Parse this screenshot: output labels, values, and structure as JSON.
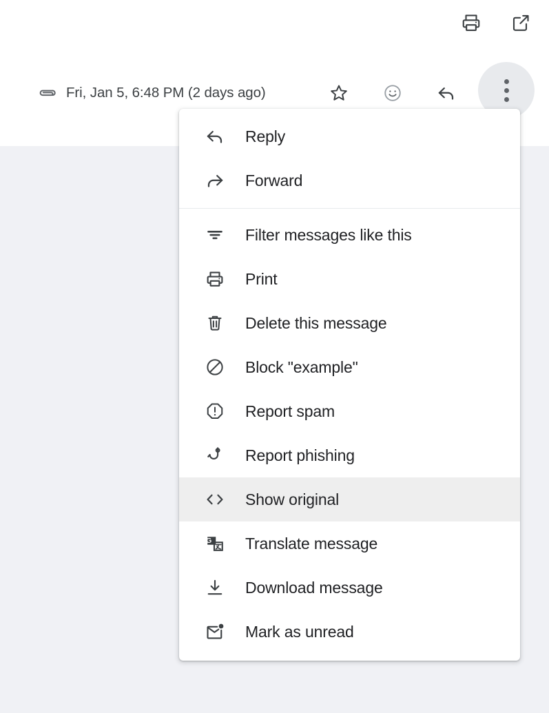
{
  "colors": {
    "pane_background": "#ffffff",
    "app_background": "#f0f1f5",
    "menu_background": "#ffffff",
    "menu_highlight": "#eeeeee",
    "divider": "#e8eaed",
    "icon": "#3c4043",
    "text": "#202124",
    "secondary_text": "#3c4043",
    "active_button_background": "#e8eaed"
  },
  "top_toolbar": {
    "buttons": [
      {
        "name": "print-all-button",
        "icon": "print-icon",
        "label": "Print all"
      },
      {
        "name": "open-in-new-window-button",
        "icon": "open-in-new-icon",
        "label": "Open in new window"
      }
    ]
  },
  "message_header": {
    "attachment_icon": "attachment-icon",
    "date": "Fri, Jan 5, 6:48 PM (2 days ago)",
    "actions": [
      {
        "name": "star-button",
        "icon": "star-outline-icon",
        "label": "Star"
      },
      {
        "name": "add-reaction-button",
        "icon": "emoji-smile-icon",
        "label": "Add reaction"
      },
      {
        "name": "reply-button",
        "icon": "reply-arrow-icon",
        "label": "Reply"
      }
    ],
    "more_options": {
      "name": "more-options-button",
      "icon": "more-vert-icon",
      "label": "More",
      "active": true
    }
  },
  "more_options_menu": {
    "groups": [
      {
        "items": [
          {
            "icon": "reply-arrow-icon",
            "label": "Reply",
            "highlighted": false
          },
          {
            "icon": "forward-arrow-icon",
            "label": "Forward",
            "highlighted": false
          }
        ]
      },
      {
        "items": [
          {
            "icon": "filter-icon",
            "label": "Filter messages like this",
            "highlighted": false
          },
          {
            "icon": "print-icon",
            "label": "Print",
            "highlighted": false
          },
          {
            "icon": "trash-icon",
            "label": "Delete this message",
            "highlighted": false
          },
          {
            "icon": "block-icon",
            "label": "Block \"example\"",
            "highlighted": false
          },
          {
            "icon": "report-spam-icon",
            "label": "Report spam",
            "highlighted": false
          },
          {
            "icon": "phishing-hook-icon",
            "label": "Report phishing",
            "highlighted": false
          },
          {
            "icon": "code-brackets-icon",
            "label": "Show original",
            "highlighted": true
          },
          {
            "icon": "translate-icon",
            "label": "Translate message",
            "highlighted": false
          },
          {
            "icon": "download-icon",
            "label": "Download message",
            "highlighted": false
          },
          {
            "icon": "mark-unread-envelope-icon",
            "label": "Mark as unread",
            "highlighted": false
          }
        ]
      }
    ]
  }
}
